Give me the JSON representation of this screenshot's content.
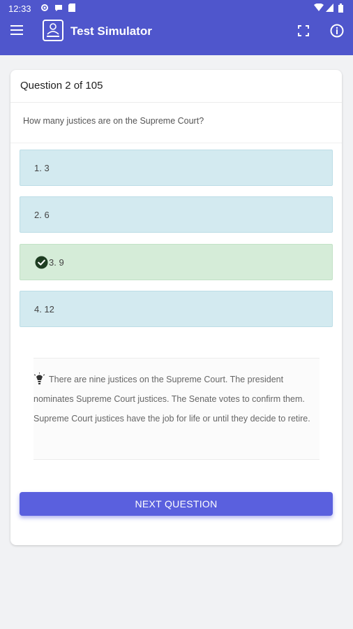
{
  "status_bar": {
    "time": "12:33"
  },
  "toolbar": {
    "title": "Test Simulator"
  },
  "card": {
    "header": "Question 2 of 105",
    "question": "How many justices are on the Supreme Court?",
    "options": [
      {
        "label": "1. 3",
        "state": "neutral"
      },
      {
        "label": "2. 6",
        "state": "neutral"
      },
      {
        "label": "3. 9",
        "state": "correct"
      },
      {
        "label": "4. 12",
        "state": "neutral"
      }
    ],
    "explanation": "There are nine justices on the Supreme Court. The president nominates Supreme Court justices. The Senate votes to confirm them. Supreme Court justices have the job for life or until they decide to retire.",
    "next_button": "NEXT QUESTION"
  },
  "colors": {
    "app_bar": "#4f56cc",
    "option_bg": "#d3eaf0",
    "correct_bg": "#d5ecd8",
    "button": "#5a60de"
  }
}
